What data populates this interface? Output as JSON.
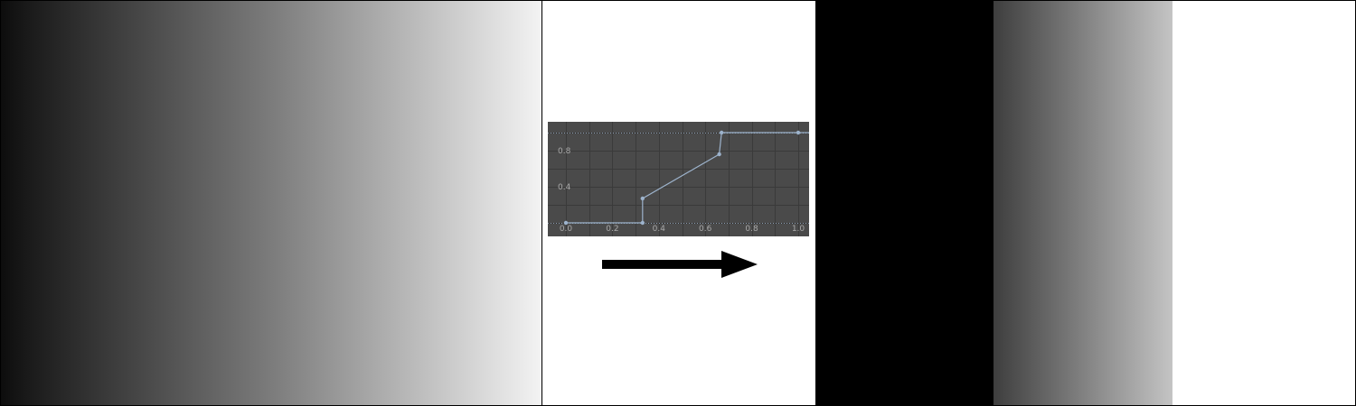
{
  "curve_editor": {
    "y_ticks": [
      "0.4",
      "0.8"
    ],
    "x_ticks": [
      "0.0",
      "0.2",
      "0.4",
      "0.6",
      "0.8",
      "1.0"
    ],
    "y_tick_values": [
      0.4,
      0.8
    ],
    "x_tick_values": [
      0.0,
      0.2,
      0.4,
      0.6,
      0.8,
      1.0
    ],
    "points": [
      {
        "x": 0.0,
        "y": 0.0
      },
      {
        "x": 0.33,
        "y": 0.0
      },
      {
        "x": 0.33,
        "y": 0.27
      },
      {
        "x": 0.66,
        "y": 0.76
      },
      {
        "x": 0.67,
        "y": 1.0
      },
      {
        "x": 1.0,
        "y": 1.0
      }
    ],
    "colors": {
      "background": "#4a4a4a",
      "grid": "#3a3a3a",
      "curve": "#9db3cc",
      "tick_text": "#a9a9a9"
    }
  },
  "colors": {
    "arrow": "#000000",
    "border": "#000000"
  }
}
